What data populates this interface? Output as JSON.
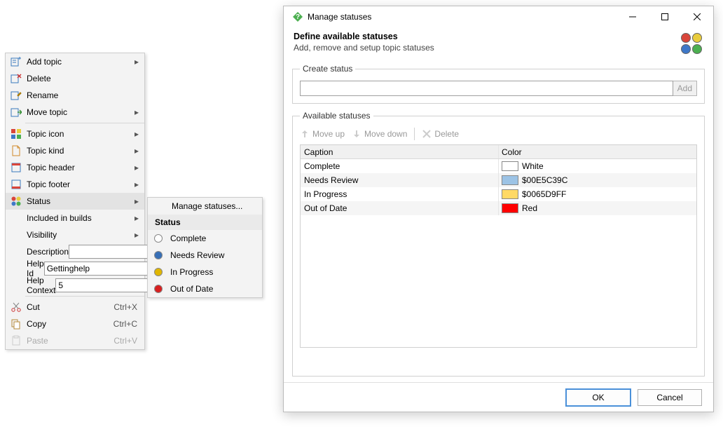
{
  "context_menu": {
    "add_topic": "Add topic",
    "delete": "Delete",
    "rename": "Rename",
    "move_topic": "Move topic",
    "topic_icon": "Topic icon",
    "topic_kind": "Topic kind",
    "topic_header": "Topic header",
    "topic_footer": "Topic footer",
    "status": "Status",
    "included_in_builds": "Included in builds",
    "visibility": "Visibility",
    "description_label": "Description",
    "description_value": "",
    "help_id_label": "Help Id",
    "help_id_value": "Gettinghelp",
    "help_context_label": "Help Context",
    "help_context_value": "5",
    "cut": "Cut",
    "cut_shortcut": "Ctrl+X",
    "copy": "Copy",
    "copy_shortcut": "Ctrl+C",
    "paste": "Paste",
    "paste_shortcut": "Ctrl+V"
  },
  "status_submenu": {
    "manage": "Manage statuses...",
    "header": "Status",
    "items": [
      {
        "label": "Complete",
        "color": "#ffffff"
      },
      {
        "label": "Needs Review",
        "color": "#376fb6"
      },
      {
        "label": "In Progress",
        "color": "#e0b600"
      },
      {
        "label": "Out of Date",
        "color": "#d81f1f"
      }
    ]
  },
  "dialog": {
    "title": "Manage statuses",
    "heading": "Define available statuses",
    "subheading": "Add, remove and setup topic statuses",
    "create_legend": "Create status",
    "add_button": "Add",
    "available_legend": "Available statuses",
    "toolbar": {
      "move_up": "Move up",
      "move_down": "Move down",
      "delete": "Delete"
    },
    "table": {
      "caption_header": "Caption",
      "color_header": "Color",
      "rows": [
        {
          "caption": "Complete",
          "color_label": "White",
          "swatch": "#ffffff"
        },
        {
          "caption": "Needs Review",
          "color_label": "$00E5C39C",
          "swatch": "#9cc3e5"
        },
        {
          "caption": "In Progress",
          "color_label": "$0065D9FF",
          "swatch": "#ffd965"
        },
        {
          "caption": "Out of Date",
          "color_label": "Red",
          "swatch": "#ff0000"
        }
      ]
    },
    "ok": "OK",
    "cancel": "Cancel"
  },
  "header_icon_colors": [
    "#d9453a",
    "#e9cc3d",
    "#3e78c8",
    "#4caf50"
  ]
}
